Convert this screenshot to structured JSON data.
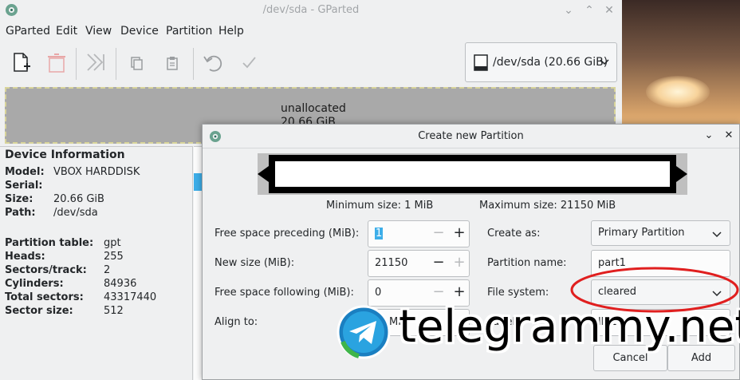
{
  "window": {
    "title": "/dev/sda - GParted"
  },
  "menu": [
    "GParted",
    "Edit",
    "View",
    "Device",
    "Partition",
    "Help"
  ],
  "toolbar": {
    "icons": [
      "new-partition-icon",
      "delete-icon",
      "resize-move-icon",
      "copy-icon",
      "paste-icon",
      "undo-icon",
      "apply-icon"
    ]
  },
  "device_selector": {
    "value": "/dev/sda (20.66 GiB)"
  },
  "disk_graphic": {
    "label": "unallocated",
    "size": "20.66 GiB"
  },
  "device_info": {
    "header": "Device Information",
    "rows": [
      {
        "k": "Model:",
        "v": "VBOX HARDDISK"
      },
      {
        "k": "Serial:",
        "v": ""
      },
      {
        "k": "Size:",
        "v": "20.66 GiB"
      },
      {
        "k": "Path:",
        "v": "/dev/sda"
      },
      {
        "k": "Partition table:",
        "v": "gpt"
      },
      {
        "k": "Heads:",
        "v": "255"
      },
      {
        "k": "Sectors/track:",
        "v": "2"
      },
      {
        "k": "Cylinders:",
        "v": "84936"
      },
      {
        "k": "Total sectors:",
        "v": "43317440"
      },
      {
        "k": "Sector size:",
        "v": "512"
      }
    ]
  },
  "dialog": {
    "title": "Create new Partition",
    "min_size": "Minimum size: 1 MiB",
    "max_size": "Maximum size: 21150 MiB",
    "free_preceding_label": "Free space preceding (MiB):",
    "free_preceding_value": "1",
    "new_size_label": "New size (MiB):",
    "new_size_value": "21150",
    "free_following_label": "Free space following (MiB):",
    "free_following_value": "0",
    "align_to_label": "Align to:",
    "align_to_value": "MiB",
    "create_as_label": "Create as:",
    "create_as_value": "Primary Partition",
    "partition_name_label": "Partition name:",
    "partition_name_value": "part1",
    "file_system_label": "File system:",
    "file_system_value": "cleared",
    "label_label": "Label:",
    "label_value": "lbl1",
    "cancel": "Cancel",
    "add": "Add"
  },
  "watermark": {
    "text": "telegrammy.net"
  },
  "colors": {
    "accent": "#3daee9",
    "annotation": "#e01f1f"
  }
}
